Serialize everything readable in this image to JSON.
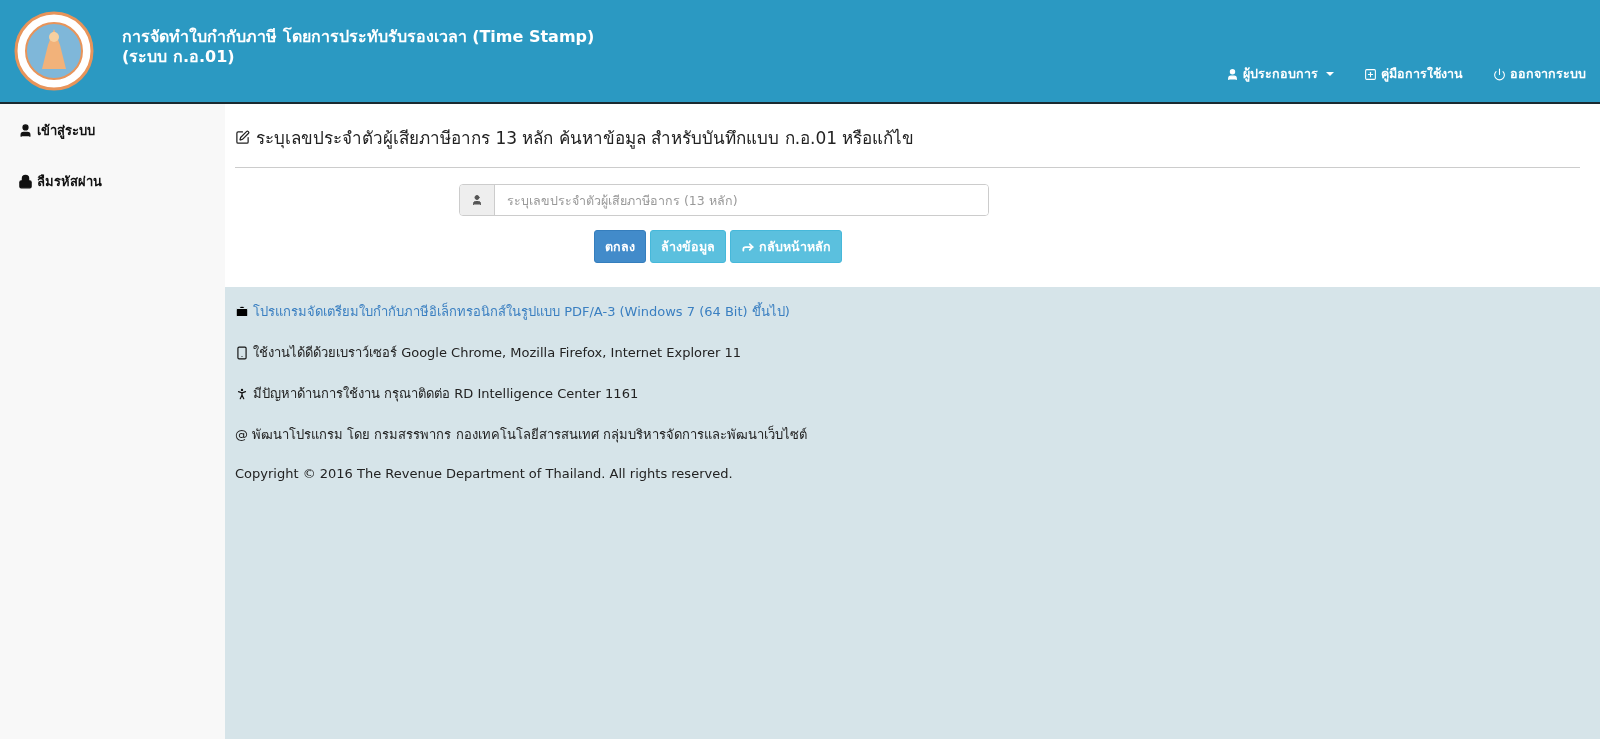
{
  "header": {
    "title_line_1": "การจัดทำใบกำกับภาษี โดยการประทับรับรองเวลา (Time Stamp)",
    "title_line_2": "(ระบบ ก.อ.01)",
    "nav": [
      {
        "label": "ผู้ประกอบการ"
      },
      {
        "label": "คู่มือการใช้งาน"
      },
      {
        "label": "ออกจากระบบ"
      }
    ]
  },
  "sidebar": {
    "items": [
      {
        "label": "เข้าสู่ระบบ"
      },
      {
        "label": "ลืมรหัสผ่าน"
      }
    ]
  },
  "form": {
    "heading": "ระบุเลขประจำตัวผู้เสียภาษีอากร 13 หลัก ค้นหาข้อมูล สำหรับบันทึกแบบ ก.อ.01 หรือแก้ไข",
    "placeholder": "ระบุเลขประจำตัวผู้เสียภาษีอากร (13 หลัก)",
    "buttons": [
      {
        "label": "ตกลง",
        "kind": "primary"
      },
      {
        "label": "ล้างข้อมูล",
        "kind": "info"
      },
      {
        "label": "กลับหน้าหลัก",
        "kind": "share"
      }
    ]
  },
  "footer": {
    "lines": [
      {
        "text": "โปรแกรมจัดเตรียมใบกำกับภาษีอิเล็กทรอนิกส์ในรูปแบบ PDF/A-3 (Windows 7 (64 Bit) ขึ้นไป)",
        "kind": "link"
      },
      {
        "text": "ใช้งานได้ดีด้วยเบราว์เซอร์ Google Chrome, Mozilla Firefox, Internet Explorer 11",
        "kind": "text"
      },
      {
        "text": "มีปัญหาด้านการใช้งาน กรุณาติดต่อ RD Intelligence Center 1161",
        "kind": "text"
      },
      {
        "text": "@ พัฒนาโปรแกรม โดย กรมสรรพากร กองเทคโนโลยีสารสนเทศ กลุ่มบริหารจัดการและพัฒนาเว็บไซต์",
        "kind": "text"
      },
      {
        "text": "Copyright © 2016 The Revenue Department of Thailand. All rights reserved.",
        "kind": "text"
      }
    ]
  }
}
